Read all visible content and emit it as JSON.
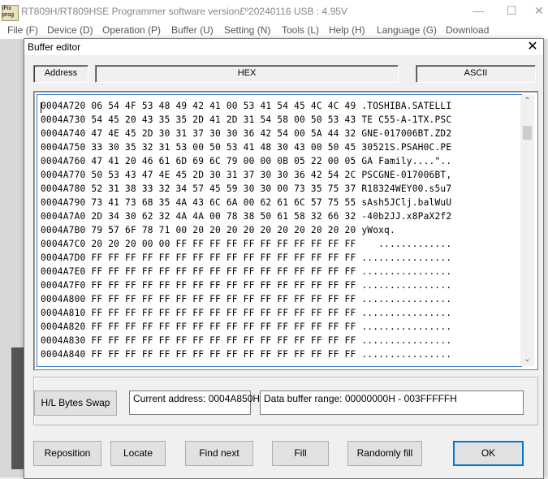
{
  "app": {
    "logo_text": "iFix prog",
    "title": "RT809H/RT809HSE Programmer software version£º20240116  USB : 4.95V",
    "window_controls": {
      "minimize": "—",
      "maximize": "☐",
      "close": "✕"
    },
    "menu": [
      "File (F)",
      "Device (D)",
      "Operation (P)",
      "Buffer (U)",
      "Setting (N)",
      "Tools (L)",
      "Help (H)",
      "Language (G)",
      "Download"
    ]
  },
  "dialog": {
    "title": "Buffer editor",
    "close_glyph": "✕",
    "headers": {
      "address": "Address",
      "hex": "HEX",
      "ascii": "ASCII"
    },
    "rows": [
      "0004A720 06 54 4F 53 48 49 42 41 00 53 41 54 45 4C 4C 49 .TOSHIBA.SATELLI",
      "0004A730 54 45 20 43 35 35 2D 41 2D 31 54 58 00 50 53 43 TE C55-A-1TX.PSC",
      "0004A740 47 4E 45 2D 30 31 37 30 30 36 42 54 00 5A 44 32 GNE-017006BT.ZD2",
      "0004A750 33 30 35 32 31 53 00 50 53 41 48 30 43 00 50 45 30521S.PSAH0C.PE",
      "0004A760 47 41 20 46 61 6D 69 6C 79 00 00 0B 05 22 00 05 GA Family....\"..",
      "0004A770 50 53 43 47 4E 45 2D 30 31 37 30 30 36 42 54 2C PSCGNE-017006BT,",
      "0004A780 52 31 38 33 32 34 57 45 59 30 30 00 73 35 75 37 R18324WEY00.s5u7",
      "0004A790 73 41 73 68 35 4A 43 6C 6A 00 62 61 6C 57 75 55 sAsh5JClj.balWuU",
      "0004A7A0 2D 34 30 62 32 4A 4A 00 78 38 50 61 58 32 66 32 -40b2JJ.x8PaX2f2",
      "0004A7B0 79 57 6F 78 71 00 20 20 20 20 20 20 20 20 20 20 yWoxq.",
      "0004A7C0 20 20 20 00 00 FF FF FF FF FF FF FF FF FF FF FF    .............",
      "0004A7D0 FF FF FF FF FF FF FF FF FF FF FF FF FF FF FF FF ................",
      "0004A7E0 FF FF FF FF FF FF FF FF FF FF FF FF FF FF FF FF ................",
      "0004A7F0 FF FF FF FF FF FF FF FF FF FF FF FF FF FF FF FF ................",
      "0004A800 FF FF FF FF FF FF FF FF FF FF FF FF FF FF FF FF ................",
      "0004A810 FF FF FF FF FF FF FF FF FF FF FF FF FF FF FF FF ................",
      "0004A820 FF FF FF FF FF FF FF FF FF FF FF FF FF FF FF FF ................",
      "0004A830 FF FF FF FF FF FF FF FF FF FF FF FF FF FF FF FF ................",
      "0004A840 FF FF FF FF FF FF FF FF FF FF FF FF FF FF FF FF ................"
    ],
    "scroll_up": "⌃",
    "scroll_down": "⌄",
    "swap_button": "H/L Bytes Swap",
    "current_address": "Current address: 0004A850H",
    "data_buffer_range": "Data buffer range: 00000000H - 003FFFFFH",
    "buttons": {
      "reposition": "Reposition",
      "locate": "Locate",
      "find_next": "Find next",
      "fill": "Fill",
      "randomly_fill": "Randomly fill",
      "ok": "OK"
    }
  }
}
